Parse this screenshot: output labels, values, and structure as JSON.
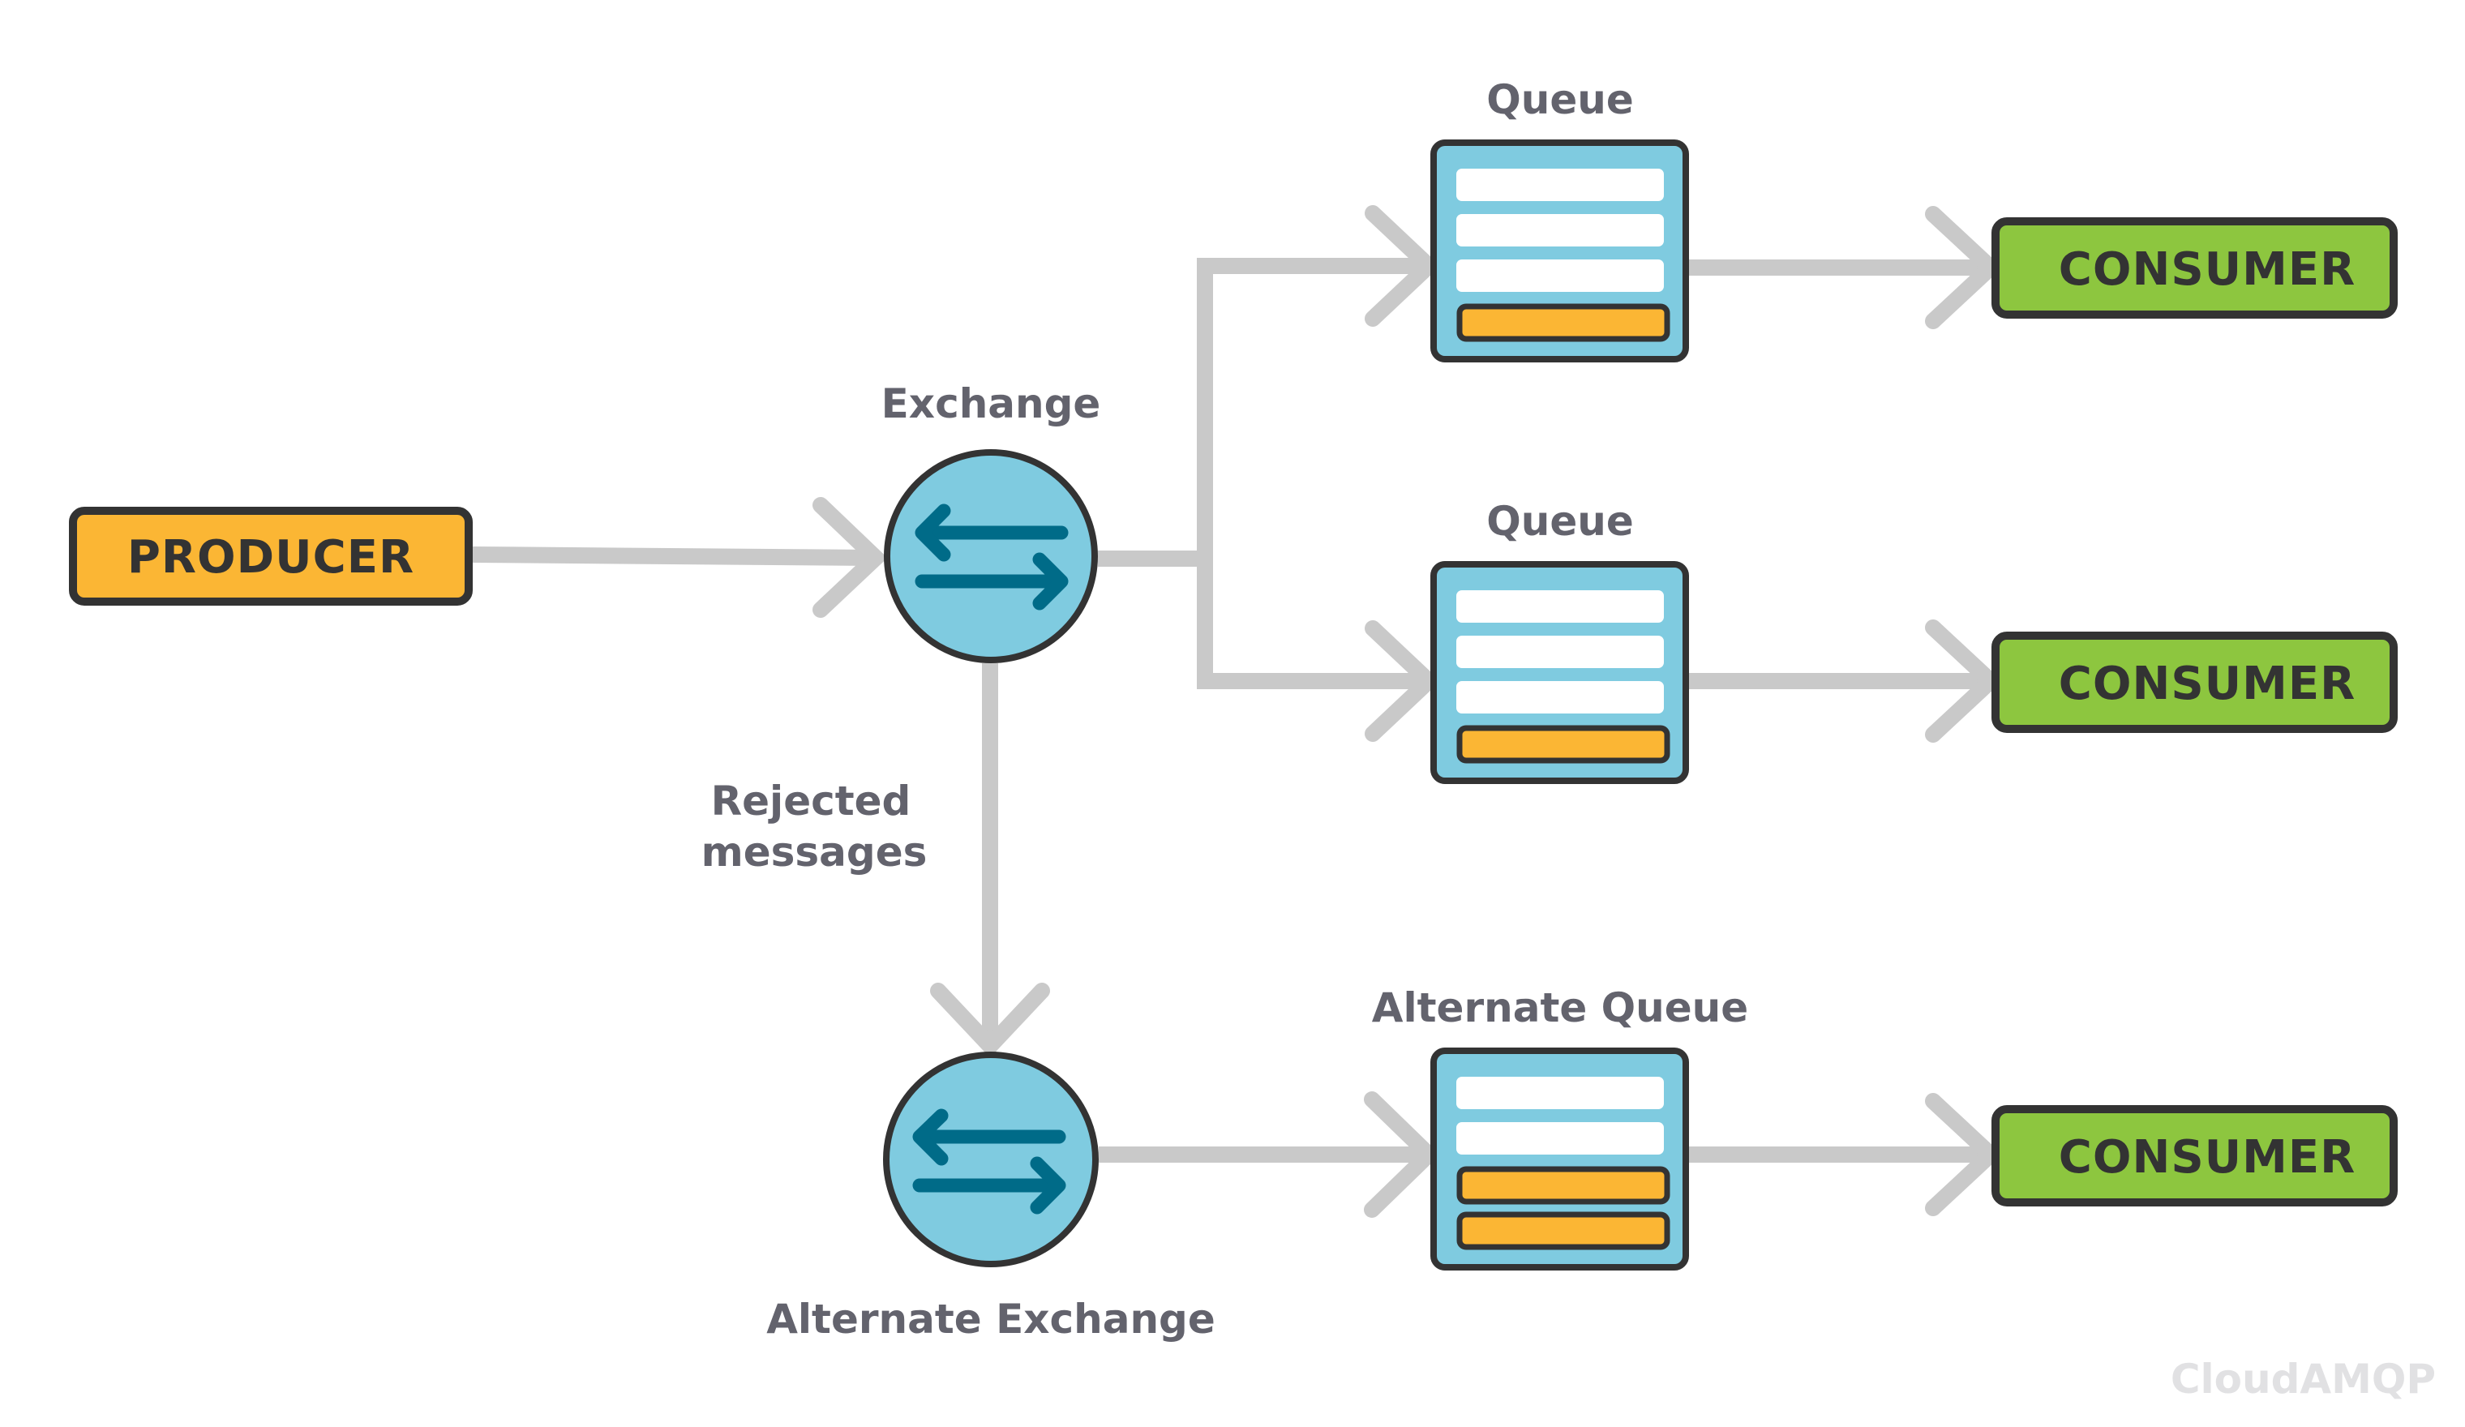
{
  "diagram": {
    "producer": {
      "label": "PRODUCER"
    },
    "exchange": {
      "label": "Exchange"
    },
    "queues": [
      {
        "label": "Queue",
        "messages": [
          "empty",
          "empty",
          "empty",
          "filled"
        ]
      },
      {
        "label": "Queue",
        "messages": [
          "empty",
          "empty",
          "empty",
          "filled"
        ]
      }
    ],
    "rejected_label": {
      "line1": "Rejected",
      "line2": "messages"
    },
    "alternate_exchange": {
      "label": "Alternate Exchange"
    },
    "alternate_queue": {
      "label": "Alternate Queue",
      "messages": [
        "empty",
        "empty",
        "filled",
        "filled"
      ]
    },
    "consumers": [
      {
        "label": "CONSUMER"
      },
      {
        "label": "CONSUMER"
      },
      {
        "label": "CONSUMER"
      }
    ],
    "brand": "CloudAMQP",
    "edges": [
      {
        "from": "producer",
        "to": "exchange"
      },
      {
        "from": "exchange",
        "to": "queue-1"
      },
      {
        "from": "exchange",
        "to": "queue-2"
      },
      {
        "from": "exchange",
        "to": "alternate-exchange",
        "label": "Rejected messages"
      },
      {
        "from": "queue-1",
        "to": "consumer-1"
      },
      {
        "from": "queue-2",
        "to": "consumer-2"
      },
      {
        "from": "alternate-exchange",
        "to": "alternate-queue"
      },
      {
        "from": "alternate-queue",
        "to": "consumer-3"
      }
    ],
    "colors": {
      "producer_fill": "#fbb634",
      "consumer_fill": "#8dc63f",
      "exchange_fill": "#7fcbe0",
      "queue_fill": "#7fcbe0",
      "arrow_icon": "#006b88",
      "message_empty": "#ffffff",
      "message_filled": "#fbb634",
      "outline": "#333333",
      "connector": "#c9c9c9",
      "label": "#63636d",
      "brand": "#e1e1e3"
    }
  }
}
